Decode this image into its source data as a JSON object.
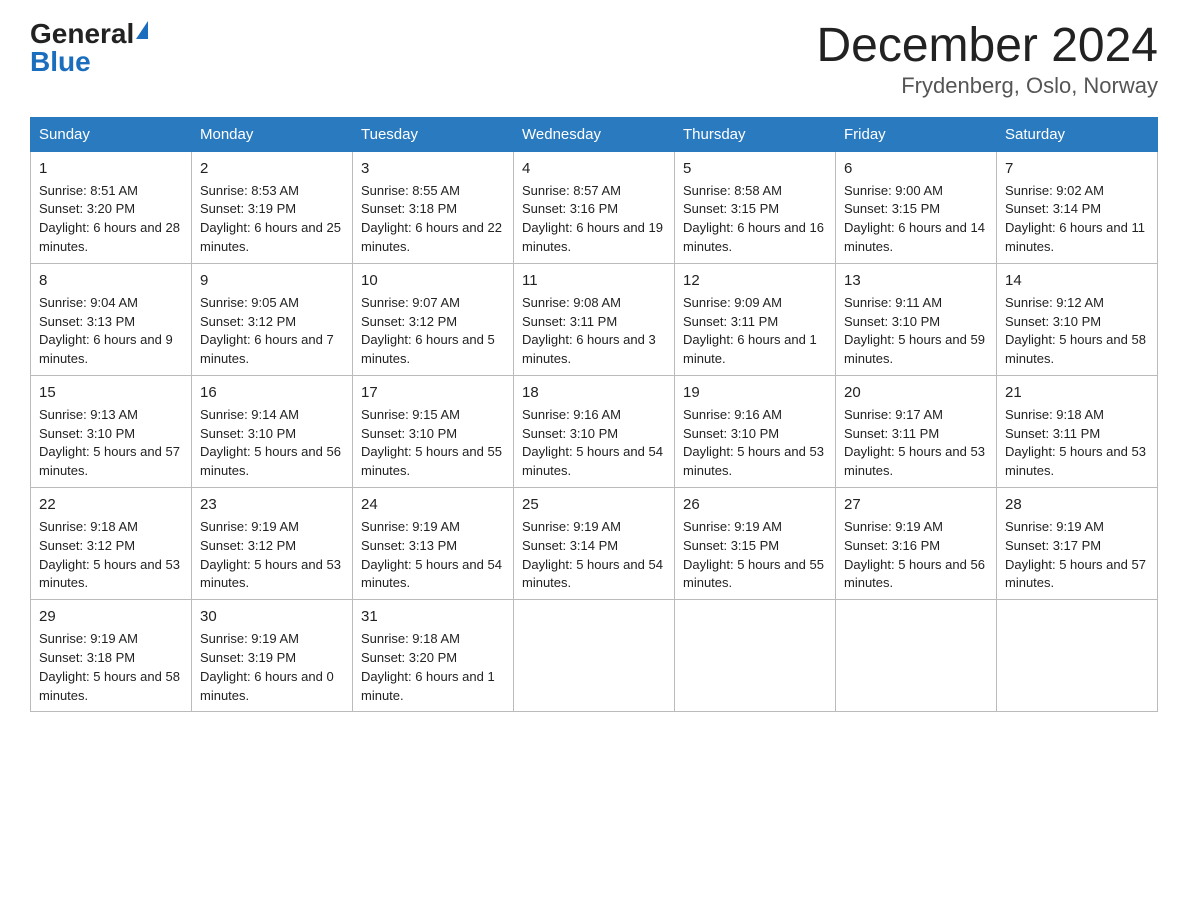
{
  "header": {
    "logo_general": "General",
    "logo_blue": "Blue",
    "title": "December 2024",
    "subtitle": "Frydenberg, Oslo, Norway"
  },
  "weekdays": [
    "Sunday",
    "Monday",
    "Tuesday",
    "Wednesday",
    "Thursday",
    "Friday",
    "Saturday"
  ],
  "weeks": [
    [
      {
        "day": "1",
        "sunrise": "8:51 AM",
        "sunset": "3:20 PM",
        "daylight": "6 hours and 28 minutes."
      },
      {
        "day": "2",
        "sunrise": "8:53 AM",
        "sunset": "3:19 PM",
        "daylight": "6 hours and 25 minutes."
      },
      {
        "day": "3",
        "sunrise": "8:55 AM",
        "sunset": "3:18 PM",
        "daylight": "6 hours and 22 minutes."
      },
      {
        "day": "4",
        "sunrise": "8:57 AM",
        "sunset": "3:16 PM",
        "daylight": "6 hours and 19 minutes."
      },
      {
        "day": "5",
        "sunrise": "8:58 AM",
        "sunset": "3:15 PM",
        "daylight": "6 hours and 16 minutes."
      },
      {
        "day": "6",
        "sunrise": "9:00 AM",
        "sunset": "3:15 PM",
        "daylight": "6 hours and 14 minutes."
      },
      {
        "day": "7",
        "sunrise": "9:02 AM",
        "sunset": "3:14 PM",
        "daylight": "6 hours and 11 minutes."
      }
    ],
    [
      {
        "day": "8",
        "sunrise": "9:04 AM",
        "sunset": "3:13 PM",
        "daylight": "6 hours and 9 minutes."
      },
      {
        "day": "9",
        "sunrise": "9:05 AM",
        "sunset": "3:12 PM",
        "daylight": "6 hours and 7 minutes."
      },
      {
        "day": "10",
        "sunrise": "9:07 AM",
        "sunset": "3:12 PM",
        "daylight": "6 hours and 5 minutes."
      },
      {
        "day": "11",
        "sunrise": "9:08 AM",
        "sunset": "3:11 PM",
        "daylight": "6 hours and 3 minutes."
      },
      {
        "day": "12",
        "sunrise": "9:09 AM",
        "sunset": "3:11 PM",
        "daylight": "6 hours and 1 minute."
      },
      {
        "day": "13",
        "sunrise": "9:11 AM",
        "sunset": "3:10 PM",
        "daylight": "5 hours and 59 minutes."
      },
      {
        "day": "14",
        "sunrise": "9:12 AM",
        "sunset": "3:10 PM",
        "daylight": "5 hours and 58 minutes."
      }
    ],
    [
      {
        "day": "15",
        "sunrise": "9:13 AM",
        "sunset": "3:10 PM",
        "daylight": "5 hours and 57 minutes."
      },
      {
        "day": "16",
        "sunrise": "9:14 AM",
        "sunset": "3:10 PM",
        "daylight": "5 hours and 56 minutes."
      },
      {
        "day": "17",
        "sunrise": "9:15 AM",
        "sunset": "3:10 PM",
        "daylight": "5 hours and 55 minutes."
      },
      {
        "day": "18",
        "sunrise": "9:16 AM",
        "sunset": "3:10 PM",
        "daylight": "5 hours and 54 minutes."
      },
      {
        "day": "19",
        "sunrise": "9:16 AM",
        "sunset": "3:10 PM",
        "daylight": "5 hours and 53 minutes."
      },
      {
        "day": "20",
        "sunrise": "9:17 AM",
        "sunset": "3:11 PM",
        "daylight": "5 hours and 53 minutes."
      },
      {
        "day": "21",
        "sunrise": "9:18 AM",
        "sunset": "3:11 PM",
        "daylight": "5 hours and 53 minutes."
      }
    ],
    [
      {
        "day": "22",
        "sunrise": "9:18 AM",
        "sunset": "3:12 PM",
        "daylight": "5 hours and 53 minutes."
      },
      {
        "day": "23",
        "sunrise": "9:19 AM",
        "sunset": "3:12 PM",
        "daylight": "5 hours and 53 minutes."
      },
      {
        "day": "24",
        "sunrise": "9:19 AM",
        "sunset": "3:13 PM",
        "daylight": "5 hours and 54 minutes."
      },
      {
        "day": "25",
        "sunrise": "9:19 AM",
        "sunset": "3:14 PM",
        "daylight": "5 hours and 54 minutes."
      },
      {
        "day": "26",
        "sunrise": "9:19 AM",
        "sunset": "3:15 PM",
        "daylight": "5 hours and 55 minutes."
      },
      {
        "day": "27",
        "sunrise": "9:19 AM",
        "sunset": "3:16 PM",
        "daylight": "5 hours and 56 minutes."
      },
      {
        "day": "28",
        "sunrise": "9:19 AM",
        "sunset": "3:17 PM",
        "daylight": "5 hours and 57 minutes."
      }
    ],
    [
      {
        "day": "29",
        "sunrise": "9:19 AM",
        "sunset": "3:18 PM",
        "daylight": "5 hours and 58 minutes."
      },
      {
        "day": "30",
        "sunrise": "9:19 AM",
        "sunset": "3:19 PM",
        "daylight": "6 hours and 0 minutes."
      },
      {
        "day": "31",
        "sunrise": "9:18 AM",
        "sunset": "3:20 PM",
        "daylight": "6 hours and 1 minute."
      },
      null,
      null,
      null,
      null
    ]
  ]
}
